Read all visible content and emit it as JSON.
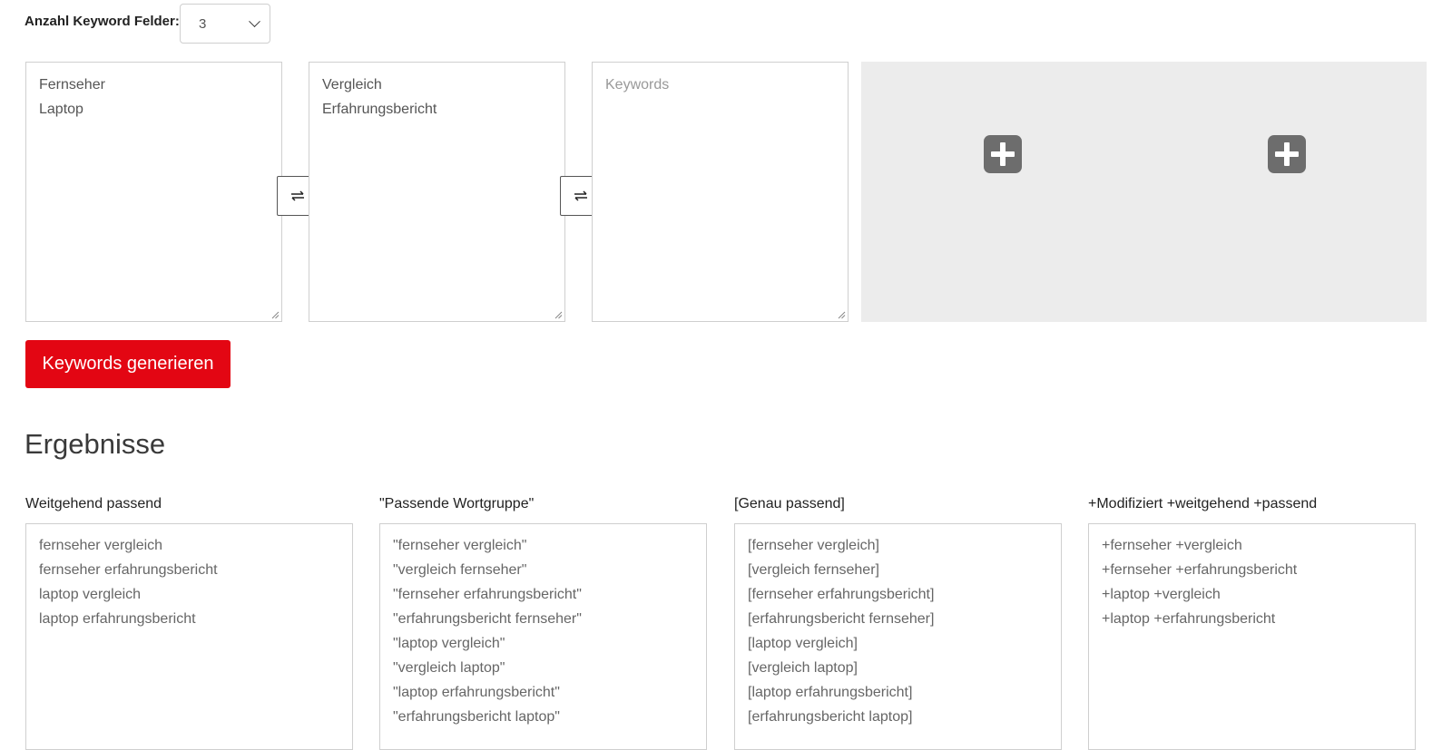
{
  "count": {
    "label": "Anzahl Keyword Felder:",
    "value": "3"
  },
  "keyword_fields": [
    {
      "lines": [
        "Fernseher",
        "Laptop"
      ],
      "placeholder": ""
    },
    {
      "lines": [
        "Vergleich",
        "Erfahrungsbericht"
      ],
      "placeholder": ""
    },
    {
      "lines": [],
      "placeholder": "Keywords"
    }
  ],
  "generate_button": "Keywords generieren",
  "results": {
    "title": "Ergebnisse",
    "columns": [
      {
        "label": "Weitgehend passend",
        "lines": [
          "fernseher vergleich",
          "fernseher erfahrungsbericht",
          "laptop vergleich",
          "laptop erfahrungsbericht"
        ]
      },
      {
        "label": "\"Passende Wortgruppe\"",
        "lines": [
          "\"fernseher vergleich\"",
          "\"vergleich fernseher\"",
          "\"fernseher erfahrungsbericht\"",
          "\"erfahrungsbericht fernseher\"",
          "\"laptop vergleich\"",
          "\"vergleich laptop\"",
          "\"laptop erfahrungsbericht\"",
          "\"erfahrungsbericht laptop\""
        ]
      },
      {
        "label": "[Genau passend]",
        "lines": [
          "[fernseher vergleich]",
          "[vergleich fernseher]",
          "[fernseher erfahrungsbericht]",
          "[erfahrungsbericht fernseher]",
          "[laptop vergleich]",
          "[vergleich laptop]",
          "[laptop erfahrungsbericht]",
          "[erfahrungsbericht laptop]"
        ]
      },
      {
        "label": "+Modifiziert +weitgehend +passend",
        "lines": [
          "+fernseher +vergleich",
          "+fernseher +erfahrungsbericht",
          "+laptop +vergleich",
          "+laptop +erfahrungsbericht"
        ]
      }
    ]
  },
  "colors": {
    "accent": "#e30613",
    "add_area": "#ececec",
    "plus_icon": "#6d6d6d"
  },
  "icons": {
    "swap": "swap-arrows-icon",
    "plus": "plus-square-icon",
    "select": "chevron-down-icon",
    "resize": "resize-grip-icon"
  }
}
